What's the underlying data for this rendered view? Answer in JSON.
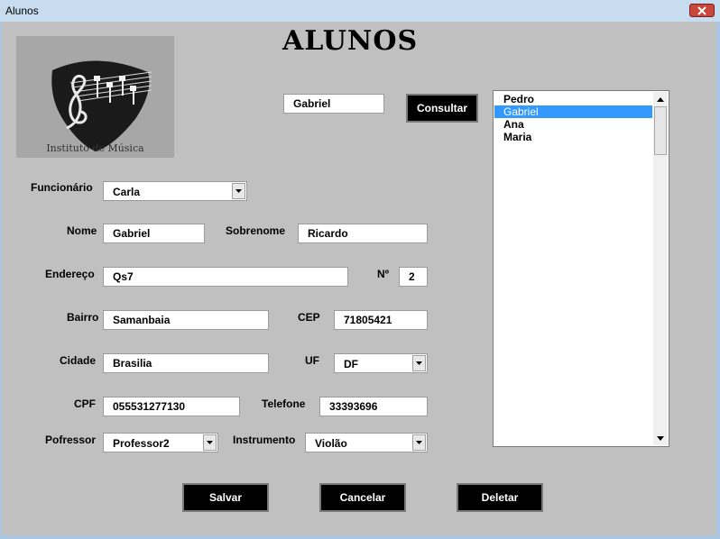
{
  "window": {
    "title": "Alunos"
  },
  "form": {
    "heading": "ALUNOS",
    "logo_text": "Instituto de Música"
  },
  "search": {
    "value": "Gabriel",
    "button": "Consultar"
  },
  "list": {
    "items": [
      "Pedro",
      "Gabriel",
      "Ana",
      "Maria"
    ],
    "selected": "Gabriel"
  },
  "fields": {
    "funcionario": {
      "label": "Funcionário",
      "value": "Carla"
    },
    "nome": {
      "label": "Nome",
      "value": "Gabriel"
    },
    "sobrenome": {
      "label": "Sobrenome",
      "value": "Ricardo"
    },
    "endereco": {
      "label": "Endereço",
      "value": "Qs7"
    },
    "numero": {
      "label": "Nº",
      "value": "2"
    },
    "bairro": {
      "label": "Bairro",
      "value": "Samanbaia"
    },
    "cep": {
      "label": "CEP",
      "value": "71805421"
    },
    "cidade": {
      "label": "Cidade",
      "value": "Brasilia"
    },
    "uf": {
      "label": "UF",
      "value": "DF"
    },
    "cpf": {
      "label": "CPF",
      "value": "055531277130"
    },
    "telefone": {
      "label": "Telefone",
      "value": "33393696"
    },
    "professor": {
      "label": "Pofressor",
      "value": "Professor2"
    },
    "instrumento": {
      "label": "Instrumento",
      "value": "Violão"
    }
  },
  "buttons": {
    "save": "Salvar",
    "cancel": "Cancelar",
    "delete": "Deletar"
  },
  "colors": {
    "selection": "#3399ff",
    "button_bg": "#000000",
    "form_bg": "#c0c0c0"
  }
}
